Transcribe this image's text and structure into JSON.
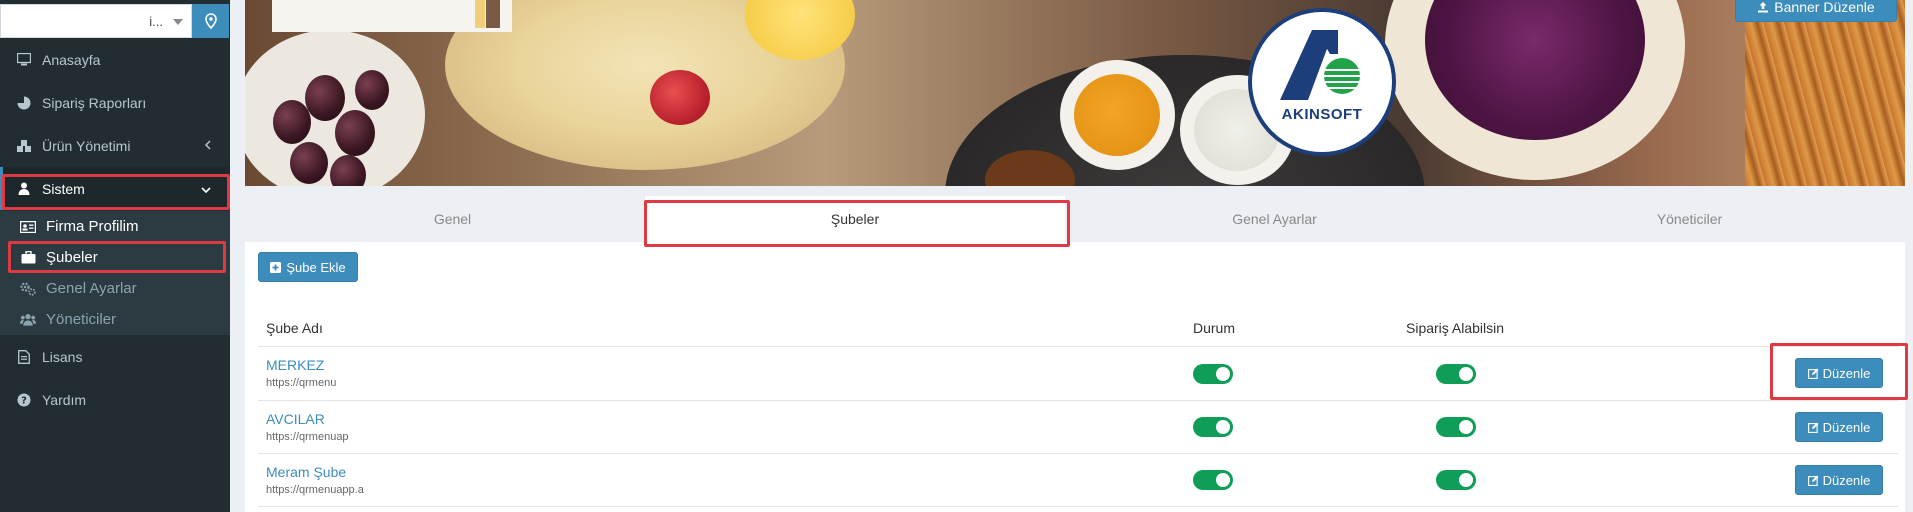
{
  "sidebar": {
    "select_value": "i...",
    "items": [
      {
        "label": "Anasayfa",
        "icon": "desktop-icon"
      },
      {
        "label": "Sipariş Raporları",
        "icon": "pie-chart-icon"
      },
      {
        "label": "Ürün Yönetimi",
        "icon": "cubes-icon"
      },
      {
        "label": "Sistem",
        "icon": "user-icon"
      },
      {
        "label": "Lisans",
        "icon": "document-icon"
      },
      {
        "label": "Yardım",
        "icon": "question-circle-icon"
      }
    ],
    "subitems": [
      {
        "label": "Firma Profilim",
        "icon": "id-card-icon"
      },
      {
        "label": "Şubeler",
        "icon": "briefcase-icon"
      },
      {
        "label": "Genel Ayarlar",
        "icon": "gears-icon"
      },
      {
        "label": "Yöneticiler",
        "icon": "users-icon"
      }
    ]
  },
  "banner": {
    "logo_text": "AKINSOFT",
    "edit_button": "Banner Düzenle"
  },
  "tabs": [
    {
      "label": "Genel"
    },
    {
      "label": "Şubeler"
    },
    {
      "label": "Genel Ayarlar"
    },
    {
      "label": "Yöneticiler"
    }
  ],
  "add_button": "Şube Ekle",
  "table": {
    "headers": {
      "name": "Şube Adı",
      "status": "Durum",
      "can_order": "Sipariş Alabilsin"
    },
    "rows": [
      {
        "name": "MERKEZ",
        "url": "https://qrmenu",
        "status": true,
        "can_order": true,
        "edit": "Düzenle"
      },
      {
        "name": "AVCILAR",
        "url": "https://qrmenuap",
        "status": true,
        "can_order": true,
        "edit": "Düzenle"
      },
      {
        "name": "Meram Şube",
        "url": "https://qrmenuapp.a",
        "status": true,
        "can_order": true,
        "edit": "Düzenle"
      }
    ]
  },
  "colors": {
    "accent": "#3c8dbc",
    "toggle_on": "#0f9d58",
    "highlight": "#dd3a44",
    "sidebar_bg": "#222d32"
  }
}
